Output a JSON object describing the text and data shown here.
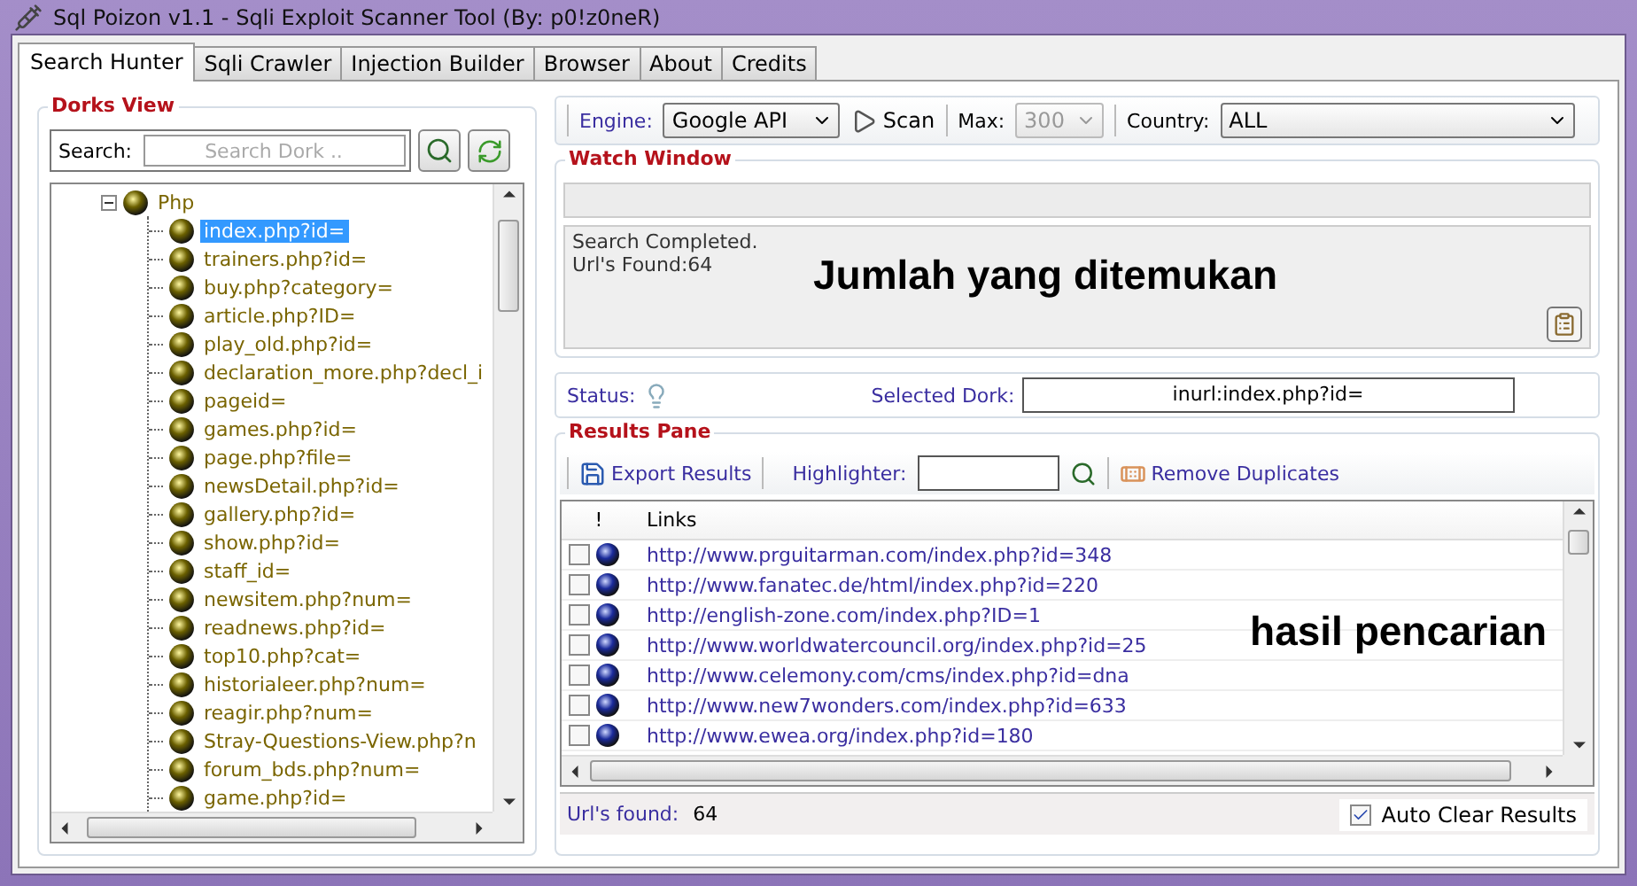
{
  "window": {
    "title": "Sql Poizon v1.1 - Sqli Exploit Scanner Tool (By: p0!z0neR)"
  },
  "tabs": [
    {
      "label": "Search Hunter",
      "selected": true
    },
    {
      "label": "Sqli Crawler",
      "selected": false
    },
    {
      "label": "Injection Builder",
      "selected": false
    },
    {
      "label": "Browser",
      "selected": false
    },
    {
      "label": "About",
      "selected": false
    },
    {
      "label": "Credits",
      "selected": false
    }
  ],
  "dorks_view": {
    "title": "Dorks View",
    "search_label": "Search:",
    "search_placeholder": "Search Dork ..",
    "tree": [
      {
        "label": "Php",
        "expanded": true,
        "selected": false,
        "children": [
          {
            "label": "index.php?id=",
            "selected": true
          },
          {
            "label": "trainers.php?id=",
            "selected": false
          },
          {
            "label": "buy.php?category=",
            "selected": false
          },
          {
            "label": "article.php?ID=",
            "selected": false
          },
          {
            "label": "play_old.php?id=",
            "selected": false
          },
          {
            "label": "declaration_more.php?decl_i",
            "selected": false
          },
          {
            "label": "pageid=",
            "selected": false
          },
          {
            "label": "games.php?id=",
            "selected": false
          },
          {
            "label": "page.php?file=",
            "selected": false
          },
          {
            "label": "newsDetail.php?id=",
            "selected": false
          },
          {
            "label": "gallery.php?id=",
            "selected": false
          },
          {
            "label": "show.php?id=",
            "selected": false
          },
          {
            "label": "staff_id=",
            "selected": false
          },
          {
            "label": "newsitem.php?num=",
            "selected": false
          },
          {
            "label": "readnews.php?id=",
            "selected": false
          },
          {
            "label": "top10.php?cat=",
            "selected": false
          },
          {
            "label": "historialeer.php?num=",
            "selected": false
          },
          {
            "label": "reagir.php?num=",
            "selected": false
          },
          {
            "label": "Stray-Questions-View.php?n",
            "selected": false
          },
          {
            "label": "forum_bds.php?num=",
            "selected": false
          },
          {
            "label": "game.php?id=",
            "selected": false
          }
        ]
      }
    ]
  },
  "engine_bar": {
    "engine_label": "Engine:",
    "engine": "Google API",
    "scan": "Scan",
    "max_label": "Max:",
    "max": "300",
    "max_disabled": true,
    "country_label": "Country:",
    "country": "ALL"
  },
  "watch_window": {
    "title": "Watch Window",
    "log": [
      "Search Completed.",
      "Url's Found:64"
    ],
    "annotation": "Jumlah yang ditemukan"
  },
  "status": {
    "label": "Status:",
    "dork_label": "Selected Dork:",
    "dork": "inurl:index.php?id="
  },
  "results_pane": {
    "title": "Results Pane",
    "export": "Export Results",
    "highlighter_label": "Highlighter:",
    "remove_duplicates": "Remove Duplicates",
    "columns": [
      "!",
      "Links"
    ],
    "rows": [
      {
        "checked": false,
        "link": "http://www.prguitarman.com/index.php?id=348"
      },
      {
        "checked": false,
        "link": "http://www.fanatec.de/html/index.php?id=220"
      },
      {
        "checked": false,
        "link": "http://english-zone.com/index.php?ID=1"
      },
      {
        "checked": false,
        "link": "http://www.worldwatercouncil.org/index.php?id=25"
      },
      {
        "checked": false,
        "link": "http://www.celemony.com/cms/index.php?id=dna"
      },
      {
        "checked": false,
        "link": "http://www.new7wonders.com/index.php?id=633"
      },
      {
        "checked": false,
        "link": "http://www.ewea.org/index.php?id=180"
      }
    ],
    "annotation": "hasil pencarian",
    "found_label": "Url's found:",
    "found": "64",
    "auto_clear": {
      "label": "Auto Clear Results",
      "checked": true
    }
  }
}
